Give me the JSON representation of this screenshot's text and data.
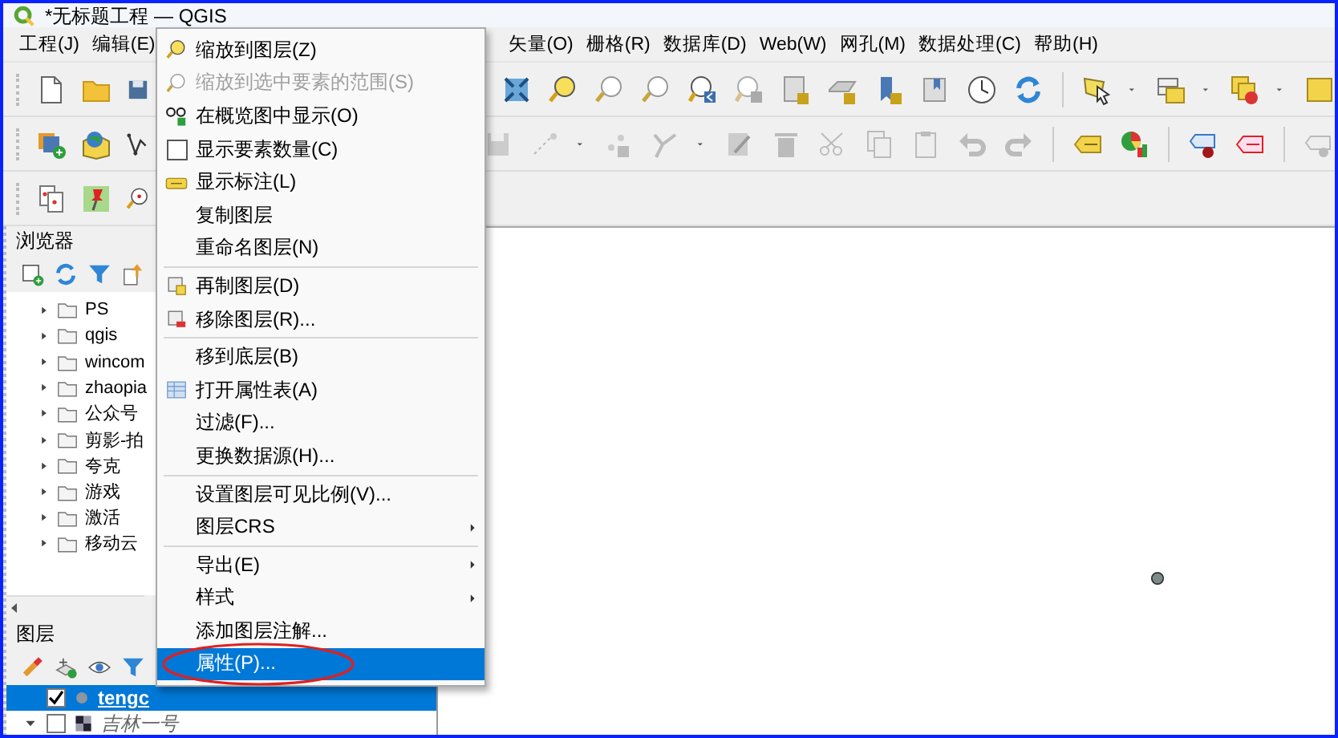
{
  "window": {
    "title": "*无标题工程 — QGIS"
  },
  "menubar": [
    {
      "label": "工程(J)"
    },
    {
      "label": "编辑(E)"
    },
    {
      "label": "矢量(O)"
    },
    {
      "label": "栅格(R)"
    },
    {
      "label": "数据库(D)"
    },
    {
      "label": "Web(W)"
    },
    {
      "label": "网孔(M)"
    },
    {
      "label": "数据处理(C)"
    },
    {
      "label": "帮助(H)"
    }
  ],
  "browser_panel": {
    "title": "浏览器",
    "items": [
      {
        "label": "PS"
      },
      {
        "label": "qgis"
      },
      {
        "label": "wincom"
      },
      {
        "label": "zhaopia"
      },
      {
        "label": "公众号"
      },
      {
        "label": "剪影-拍"
      },
      {
        "label": "夸克"
      },
      {
        "label": "游戏"
      },
      {
        "label": "激活"
      },
      {
        "label": "移动云"
      }
    ]
  },
  "layers_panel": {
    "title": "图层",
    "layers": [
      {
        "name": "tengc",
        "kind": "vector",
        "checked": true,
        "selected": true
      },
      {
        "name": "吉林一号",
        "kind": "raster",
        "checked": false,
        "selected": false,
        "expanded": true
      }
    ]
  },
  "context_menu": {
    "groups": [
      [
        {
          "label": "缩放到图层(Z)",
          "kind": "action",
          "disabled": false,
          "selected": false,
          "circled": false
        },
        {
          "label": "缩放到选中要素的范围(S)",
          "kind": "action",
          "disabled": true,
          "selected": false,
          "circled": false
        },
        {
          "label": "在概览图中显示(O)",
          "kind": "action",
          "disabled": false,
          "selected": false,
          "circled": false
        },
        {
          "label": "显示要素数量(C)",
          "kind": "check",
          "checked": false,
          "disabled": false,
          "selected": false,
          "circled": false
        },
        {
          "label": "显示标注(L)",
          "kind": "action",
          "disabled": false,
          "selected": false,
          "circled": false
        },
        {
          "label": "复制图层",
          "kind": "action",
          "disabled": false,
          "selected": false,
          "circled": false
        },
        {
          "label": "重命名图层(N)",
          "kind": "action",
          "disabled": false,
          "selected": false,
          "circled": false
        }
      ],
      [
        {
          "label": "再制图层(D)",
          "kind": "action",
          "disabled": false,
          "selected": false,
          "circled": false
        },
        {
          "label": "移除图层(R)...",
          "kind": "action",
          "disabled": false,
          "selected": false,
          "circled": false
        }
      ],
      [
        {
          "label": "移到底层(B)",
          "kind": "action",
          "disabled": false,
          "selected": false,
          "circled": false
        },
        {
          "label": "打开属性表(A)",
          "kind": "action",
          "disabled": false,
          "selected": false,
          "circled": false
        },
        {
          "label": "过滤(F)...",
          "kind": "action",
          "disabled": false,
          "selected": false,
          "circled": false
        },
        {
          "label": "更换数据源(H)...",
          "kind": "action",
          "disabled": false,
          "selected": false,
          "circled": false
        }
      ],
      [
        {
          "label": "设置图层可见比例(V)...",
          "kind": "action",
          "disabled": false,
          "selected": false,
          "circled": false
        },
        {
          "label": "图层CRS",
          "kind": "submenu",
          "disabled": false,
          "selected": false,
          "circled": false
        }
      ],
      [
        {
          "label": "导出(E)",
          "kind": "submenu",
          "disabled": false,
          "selected": false,
          "circled": false
        },
        {
          "label": "样式",
          "kind": "submenu",
          "disabled": false,
          "selected": false,
          "circled": false
        },
        {
          "label": "添加图层注解...",
          "kind": "action",
          "disabled": false,
          "selected": false,
          "circled": false
        },
        {
          "label": "属性(P)...",
          "kind": "action",
          "disabled": false,
          "selected": true,
          "circled": true
        }
      ]
    ]
  }
}
